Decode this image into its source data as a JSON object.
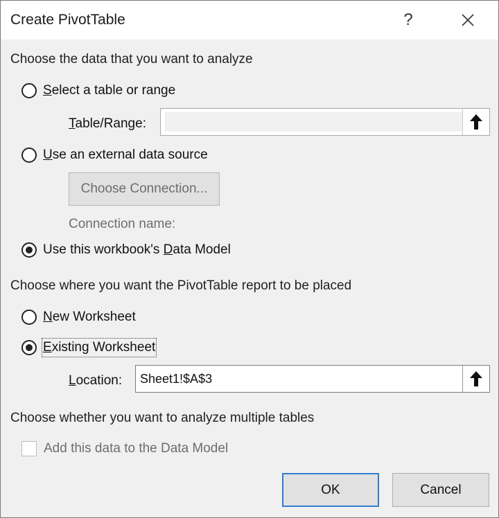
{
  "window": {
    "title": "Create PivotTable",
    "help_label": "?"
  },
  "section_data": {
    "heading": "Choose the data that you want to analyze",
    "option_table": {
      "accel": "S",
      "rest": "elect a table or range",
      "checked": false
    },
    "table_range": {
      "accel": "T",
      "rest": "able/Range:",
      "value": ""
    },
    "option_external": {
      "accel": "U",
      "rest": "se an external data source",
      "checked": false
    },
    "choose_connection_label": "Choose Connection...",
    "connection_name_label": "Connection name:",
    "option_model": {
      "before": "Use this workbook's ",
      "accel": "D",
      "rest": "ata Model",
      "checked": true
    }
  },
  "section_place": {
    "heading": "Choose where you want the PivotTable report to be placed",
    "option_new": {
      "accel": "N",
      "rest": "ew Worksheet",
      "checked": false
    },
    "option_existing": {
      "accel": "E",
      "rest": "xisting Worksheet",
      "checked": true
    },
    "location": {
      "accel": "L",
      "rest": "ocation:",
      "value": "Sheet1!$A$3"
    }
  },
  "section_multi": {
    "heading": "Choose whether you want to analyze multiple tables",
    "add_to_model_label": "Add this data to the Data Model",
    "add_to_model_checked": false
  },
  "buttons": {
    "ok_label": "OK",
    "cancel_label": "Cancel"
  },
  "colors": {
    "ok_border": "#2f7cd6",
    "dialog_bg": "#f0f0f0"
  },
  "icons": {
    "help": "question-mark-icon",
    "close": "close-icon",
    "collapse": "arrow-up-icon"
  }
}
